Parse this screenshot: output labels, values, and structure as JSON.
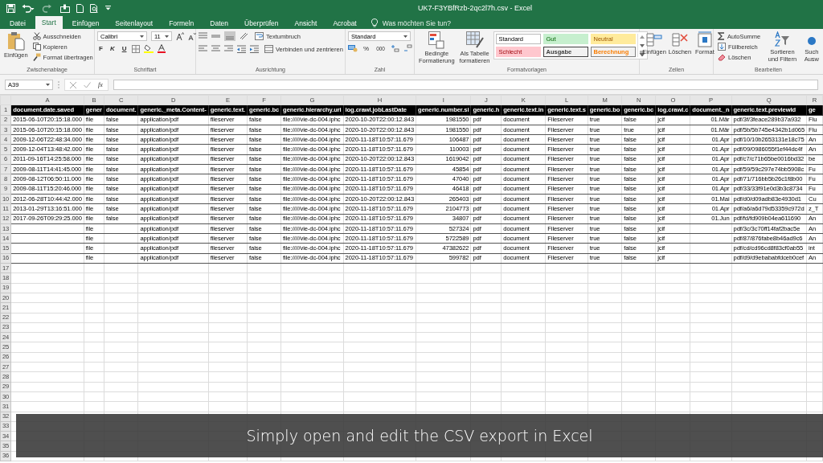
{
  "window": {
    "title": "UK7-F3YBfRzb-2qc2l7h.csv - Excel"
  },
  "tabs": [
    {
      "label": "Datei",
      "selected": false
    },
    {
      "label": "Start",
      "selected": true
    },
    {
      "label": "Einfügen",
      "selected": false
    },
    {
      "label": "Seitenlayout",
      "selected": false
    },
    {
      "label": "Formeln",
      "selected": false
    },
    {
      "label": "Daten",
      "selected": false
    },
    {
      "label": "Überprüfen",
      "selected": false
    },
    {
      "label": "Ansicht",
      "selected": false
    },
    {
      "label": "Acrobat",
      "selected": false
    }
  ],
  "tell_me": {
    "placeholder": "Was möchten Sie tun?"
  },
  "ribbon": {
    "clipboard": {
      "label": "Zwischenablage",
      "paste": "Einfügen",
      "cut": "Ausschneiden",
      "copy": "Kopieren",
      "format_painter": "Format übertragen"
    },
    "font": {
      "label": "Schriftart",
      "name": "Calibri",
      "size": "11",
      "bold": "F",
      "italic": "K",
      "underline": "U"
    },
    "alignment": {
      "label": "Ausrichtung",
      "wrap": "Textumbruch",
      "merge": "Verbinden und zentrieren"
    },
    "number": {
      "label": "Zahl",
      "format": "Standard",
      "percent": "%",
      "thousands": "000"
    },
    "styles": {
      "label": "Formatvorlagen",
      "conditional": "Bedingte Formatierung",
      "as_table": "Als Tabelle formatieren",
      "cell_styles": [
        {
          "label": "Standard",
          "kind": "normal"
        },
        {
          "label": "Gut",
          "kind": "good"
        },
        {
          "label": "Neutral",
          "kind": "neutral"
        },
        {
          "label": "Schlecht",
          "kind": "bad"
        },
        {
          "label": "Ausgabe",
          "kind": "output"
        },
        {
          "label": "Berechnung",
          "kind": "calculation"
        }
      ]
    },
    "cells": {
      "label": "Zellen",
      "insert": "Einfügen",
      "delete": "Löschen",
      "format": "Format"
    },
    "editing": {
      "label": "Bearbeiten",
      "autosum": "AutoSumme",
      "fill": "Füllbereich",
      "clear": "Löschen",
      "sort": "Sortieren und Filtern",
      "find": "Such Ausw"
    }
  },
  "formula_bar": {
    "name_box": "A39",
    "function_label": "fx"
  },
  "sheet": {
    "columns": [
      {
        "letter": "A",
        "kind": "text"
      },
      {
        "letter": "B",
        "kind": "text"
      },
      {
        "letter": "C",
        "kind": "text"
      },
      {
        "letter": "D",
        "kind": "text"
      },
      {
        "letter": "E",
        "kind": "text"
      },
      {
        "letter": "F",
        "kind": "text"
      },
      {
        "letter": "G",
        "kind": "text"
      },
      {
        "letter": "H",
        "kind": "text"
      },
      {
        "letter": "I",
        "kind": "number"
      },
      {
        "letter": "J",
        "kind": "text"
      },
      {
        "letter": "K",
        "kind": "text"
      },
      {
        "letter": "L",
        "kind": "text"
      },
      {
        "letter": "M",
        "kind": "text"
      },
      {
        "letter": "N",
        "kind": "text"
      },
      {
        "letter": "O",
        "kind": "text"
      },
      {
        "letter": "P",
        "kind": "number"
      },
      {
        "letter": "Q",
        "kind": "text"
      },
      {
        "letter": "R",
        "kind": "text"
      }
    ],
    "rows": [
      {
        "number": "1",
        "kind": "header",
        "cells": [
          "document.date.saved",
          "gener",
          "document.",
          "generic._meta.Content-",
          "generic.text.",
          "generic.bc",
          "generic.hierarchy.uri",
          "log.crawl.jobLastDate",
          "generic.number.si",
          "generic.h",
          "generic.text.in",
          "generic.text.s",
          "generic.bo",
          "generic.bc",
          "log.crawl.c",
          "document._n",
          "generic.text.previewId",
          "ge"
        ]
      },
      {
        "number": "2",
        "kind": "data",
        "cells": [
          "2015-06-10T20:15:18.000",
          "file",
          "false",
          "application/pdf",
          "fileserver",
          "false",
          "file://///vie-dc-004.iphc",
          "2020-10-20T22:00:12.843",
          "1981550",
          "pdf",
          "document",
          "Fileserver",
          "true",
          "false",
          "jcif",
          "01.Mär",
          "pdf/3f/3feace289b37a932",
          "Flu"
        ]
      },
      {
        "number": "3",
        "kind": "data",
        "cells": [
          "2015-06-10T20:15:18.000",
          "file",
          "false",
          "application/pdf",
          "fileserver",
          "false",
          "file://///vie-dc-004.iphc",
          "2020-10-20T22:00:12.843",
          "1981550",
          "pdf",
          "document",
          "Fileserver",
          "true",
          "true",
          "jcif",
          "01.Mär",
          "pdf/5b/5b745e4342b1d065",
          "Flu"
        ]
      },
      {
        "number": "4",
        "kind": "data",
        "cells": [
          "2009-12-06T22:48:34.000",
          "file",
          "false",
          "application/pdf",
          "fileserver",
          "false",
          "file://///vie-dc-004.iphc",
          "2020-11-18T10:57:11.679",
          "106487",
          "pdf",
          "document",
          "Fileserver",
          "true",
          "false",
          "jcif",
          "01.Apr",
          "pdf/10/10b2653131e18c75",
          "An"
        ]
      },
      {
        "number": "5",
        "kind": "data",
        "cells": [
          "2009-12-04T13:48:42.000",
          "file",
          "false",
          "application/pdf",
          "fileserver",
          "false",
          "file://///vie-dc-004.iphc",
          "2020-11-18T10:57:11.679",
          "110003",
          "pdf",
          "document",
          "Fileserver",
          "true",
          "false",
          "jcif",
          "01.Apr",
          "pdf/09/0986055f1ef44dc4f",
          "An"
        ]
      },
      {
        "number": "6",
        "kind": "data",
        "cells": [
          "2011-09-16T14:25:58.000",
          "file",
          "false",
          "application/pdf",
          "fileserver",
          "false",
          "file://///vie-dc-004.iphc",
          "2020-10-20T22:00:12.843",
          "1619042",
          "pdf",
          "document",
          "Fileserver",
          "true",
          "false",
          "jcif",
          "01.Apr",
          "pdf/c7/c71b65be0016bd32",
          "be"
        ]
      },
      {
        "number": "7",
        "kind": "data",
        "cells": [
          "2009-08-11T14:41:45.000",
          "file",
          "false",
          "application/pdf",
          "fileserver",
          "false",
          "file://///vie-dc-004.iphc",
          "2020-11-18T10:57:11.679",
          "45854",
          "pdf",
          "document",
          "Fileserver",
          "true",
          "false",
          "jcif",
          "01.Apr",
          "pdf/59/59c297e74bb5908c",
          "Fu"
        ]
      },
      {
        "number": "8",
        "kind": "data",
        "cells": [
          "2009-08-12T06:50:11.000",
          "file",
          "false",
          "application/pdf",
          "fileserver",
          "false",
          "file://///vie-dc-004.iphc",
          "2020-11-18T10:57:11.679",
          "47040",
          "pdf",
          "document",
          "Fileserver",
          "true",
          "false",
          "jcif",
          "01.Apr",
          "pdf/71/716bb5b26c1f8b00",
          "Fu"
        ]
      },
      {
        "number": "9",
        "kind": "data",
        "cells": [
          "2009-08-11T15:20:46.000",
          "file",
          "false",
          "application/pdf",
          "fileserver",
          "false",
          "file://///vie-dc-004.iphc",
          "2020-11-18T10:57:11.679",
          "46418",
          "pdf",
          "document",
          "Fileserver",
          "true",
          "false",
          "jcif",
          "01.Apr",
          "pdf/33/33f91e0d3b3c8734",
          "Fu"
        ]
      },
      {
        "number": "10",
        "kind": "data",
        "cells": [
          "2012-06-28T10:44:42.000",
          "file",
          "false",
          "application/pdf",
          "fileserver",
          "false",
          "file://///vie-dc-004.iphc",
          "2020-10-20T22:00:12.843",
          "265403",
          "pdf",
          "document",
          "Fileserver",
          "true",
          "false",
          "jcif",
          "01.Mai",
          "pdf/d0/d09adb83e4930d1",
          "Cu"
        ]
      },
      {
        "number": "11",
        "kind": "data",
        "cells": [
          "2013-01-29T13:16:51.000",
          "file",
          "false",
          "application/pdf",
          "fileserver",
          "false",
          "file://///vie-dc-004.iphc",
          "2020-11-18T10:57:11.679",
          "2104773",
          "pdf",
          "document",
          "Fileserver",
          "true",
          "false",
          "jcif",
          "01.Apr",
          "pdf/a6/a6d79d53359c972d",
          "z_T"
        ]
      },
      {
        "number": "12",
        "kind": "data",
        "cells": [
          "2017-09-26T09:29:25.000",
          "file",
          "false",
          "application/pdf",
          "fileserver",
          "false",
          "file://///vie-dc-004.iphc",
          "2020-11-18T10:57:11.679",
          "34807",
          "pdf",
          "document",
          "Fileserver",
          "true",
          "false",
          "jcif",
          "01.Jun",
          "pdf/fd/fd909b04ea611690",
          "An"
        ]
      },
      {
        "number": "13",
        "kind": "data",
        "cells": [
          null,
          "file",
          null,
          "application/pdf",
          "fileserver",
          "false",
          "file://///vie-dc-004.iphc",
          "2020-11-18T10:57:11.679",
          "527324",
          "pdf",
          "document",
          "Fileserver",
          "true",
          "false",
          "jcif",
          null,
          "pdf/3c/3c70ff14faf2bac5e",
          "An"
        ]
      },
      {
        "number": "14",
        "kind": "data",
        "cells": [
          null,
          "file",
          null,
          "application/pdf",
          "fileserver",
          "false",
          "file://///vie-dc-004.iphc",
          "2020-11-18T10:57:11.679",
          "5722589",
          "pdf",
          "document",
          "Fileserver",
          "true",
          "false",
          "jcif",
          null,
          "pdf/87/876fabe8b46ad9c6",
          "An"
        ]
      },
      {
        "number": "15",
        "kind": "data",
        "cells": [
          null,
          "file",
          null,
          "application/pdf",
          "fileserver",
          "false",
          "file://///vie-dc-004.iphc",
          "2020-11-18T10:57:11.679",
          "47382622",
          "pdf",
          "document",
          "Fileserver",
          "true",
          "false",
          "jcif",
          null,
          "pdf/cd/cd96cd8f83cf0ab55",
          "int"
        ]
      },
      {
        "number": "16",
        "kind": "data",
        "cells": [
          null,
          "file",
          null,
          "application/pdf",
          "fileserver",
          "false",
          "file://///vie-dc-004.iphc",
          "2020-11-18T10:57:11.679",
          "599782",
          "pdf",
          "document",
          "Fileserver",
          "true",
          "false",
          "jcif",
          null,
          "pdf/d9/d9ebababfdceb0cef",
          "An"
        ]
      }
    ],
    "empty_rows": [
      "17",
      "18",
      "19",
      "20",
      "21",
      "22",
      "23",
      "24",
      "25",
      "26",
      "27",
      "28",
      "29",
      "30",
      "31",
      "32",
      "33",
      "34",
      "35",
      "36"
    ]
  },
  "caption": "Simply open and edit the CSV export in Excel"
}
